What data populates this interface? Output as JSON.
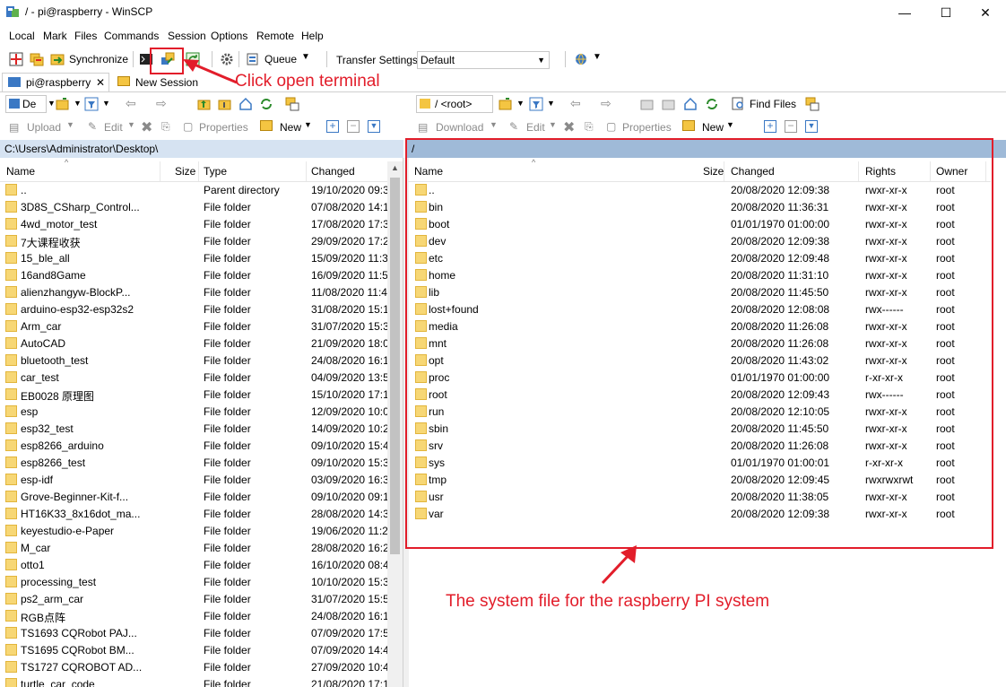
{
  "window": {
    "title": "/ - pi@raspberry - WinSCP",
    "minimize": "—",
    "maximize": "☐",
    "close": "✕"
  },
  "menu": [
    "Local",
    "Mark",
    "Files",
    "Commands",
    "Session",
    "Options",
    "Remote",
    "Help"
  ],
  "toolbar": {
    "synchronize": "Synchronize",
    "queue": "Queue",
    "transfer_settings_label": "Transfer Settings",
    "transfer_settings_value": "Default"
  },
  "tabs": {
    "session": "pi@raspberry",
    "new_session": "New Session"
  },
  "annotations": {
    "terminal": "Click open terminal",
    "system": "The system file for the raspberry PI system"
  },
  "local": {
    "drive_label": "De",
    "actions": {
      "upload": "Upload",
      "edit": "Edit",
      "properties": "Properties",
      "new": "New"
    },
    "path": "C:\\Users\\Administrator\\Desktop\\",
    "columns": {
      "name": "Name",
      "size": "Size",
      "type": "Type",
      "changed": "Changed"
    },
    "rows": [
      {
        "name": "..",
        "type": "Parent directory",
        "changed": "19/10/2020 09:3"
      },
      {
        "name": "3D8S_CSharp_Control...",
        "type": "File folder",
        "changed": "07/08/2020 14:1"
      },
      {
        "name": "4wd_motor_test",
        "type": "File folder",
        "changed": "17/08/2020 17:3"
      },
      {
        "name": "7大课程收获",
        "type": "File folder",
        "changed": "29/09/2020 17:2"
      },
      {
        "name": "15_ble_all",
        "type": "File folder",
        "changed": "15/09/2020 11:3"
      },
      {
        "name": "16and8Game",
        "type": "File folder",
        "changed": "16/09/2020 11:5"
      },
      {
        "name": "alienzhangyw-BlockP...",
        "type": "File folder",
        "changed": "11/08/2020 11:4"
      },
      {
        "name": "arduino-esp32-esp32s2",
        "type": "File folder",
        "changed": "31/08/2020 15:1"
      },
      {
        "name": "Arm_car",
        "type": "File folder",
        "changed": "31/07/2020 15:3"
      },
      {
        "name": "AutoCAD",
        "type": "File folder",
        "changed": "21/09/2020 18:0"
      },
      {
        "name": "bluetooth_test",
        "type": "File folder",
        "changed": "24/08/2020 16:1"
      },
      {
        "name": "car_test",
        "type": "File folder",
        "changed": "04/09/2020 13:5"
      },
      {
        "name": "EB0028 原理图",
        "type": "File folder",
        "changed": "15/10/2020 17:1"
      },
      {
        "name": "esp",
        "type": "File folder",
        "changed": "12/09/2020 10:0"
      },
      {
        "name": "esp32_test",
        "type": "File folder",
        "changed": "14/09/2020 10:2"
      },
      {
        "name": "esp8266_arduino",
        "type": "File folder",
        "changed": "09/10/2020 15:4"
      },
      {
        "name": "esp8266_test",
        "type": "File folder",
        "changed": "09/10/2020 15:3"
      },
      {
        "name": "esp-idf",
        "type": "File folder",
        "changed": "03/09/2020 16:3"
      },
      {
        "name": "Grove-Beginner-Kit-f...",
        "type": "File folder",
        "changed": "09/10/2020 09:1"
      },
      {
        "name": "HT16K33_8x16dot_ma...",
        "type": "File folder",
        "changed": "28/08/2020 14:3"
      },
      {
        "name": "keyestudio-e-Paper",
        "type": "File folder",
        "changed": "19/06/2020 11:2"
      },
      {
        "name": "M_car",
        "type": "File folder",
        "changed": "28/08/2020 16:2"
      },
      {
        "name": "otto1",
        "type": "File folder",
        "changed": "16/10/2020 08:4"
      },
      {
        "name": "processing_test",
        "type": "File folder",
        "changed": "10/10/2020 15:3"
      },
      {
        "name": "ps2_arm_car",
        "type": "File folder",
        "changed": "31/07/2020 15:5"
      },
      {
        "name": "RGB点阵",
        "type": "File folder",
        "changed": "24/08/2020 16:1"
      },
      {
        "name": "TS1693 CQRobot PAJ...",
        "type": "File folder",
        "changed": "07/09/2020 17:5"
      },
      {
        "name": "TS1695 CQRobot BM...",
        "type": "File folder",
        "changed": "07/09/2020 14:4"
      },
      {
        "name": "TS1727 CQROBOT AD...",
        "type": "File folder",
        "changed": "27/09/2020 10:4"
      },
      {
        "name": "turtle_car_code",
        "type": "File folder",
        "changed": "21/08/2020 17:1"
      }
    ]
  },
  "remote": {
    "path_combo": "/ <root>",
    "find_files": "Find Files",
    "actions": {
      "download": "Download",
      "edit": "Edit",
      "properties": "Properties",
      "new": "New"
    },
    "path": "/",
    "columns": {
      "name": "Name",
      "size": "Size",
      "changed": "Changed",
      "rights": "Rights",
      "owner": "Owner"
    },
    "rows": [
      {
        "name": "..",
        "changed": "20/08/2020 12:09:38",
        "rights": "rwxr-xr-x",
        "owner": "root"
      },
      {
        "name": "bin",
        "changed": "20/08/2020 11:36:31",
        "rights": "rwxr-xr-x",
        "owner": "root"
      },
      {
        "name": "boot",
        "changed": "01/01/1970 01:00:00",
        "rights": "rwxr-xr-x",
        "owner": "root"
      },
      {
        "name": "dev",
        "changed": "20/08/2020 12:09:38",
        "rights": "rwxr-xr-x",
        "owner": "root"
      },
      {
        "name": "etc",
        "changed": "20/08/2020 12:09:48",
        "rights": "rwxr-xr-x",
        "owner": "root"
      },
      {
        "name": "home",
        "changed": "20/08/2020 11:31:10",
        "rights": "rwxr-xr-x",
        "owner": "root"
      },
      {
        "name": "lib",
        "changed": "20/08/2020 11:45:50",
        "rights": "rwxr-xr-x",
        "owner": "root"
      },
      {
        "name": "lost+found",
        "changed": "20/08/2020 12:08:08",
        "rights": "rwx------",
        "owner": "root"
      },
      {
        "name": "media",
        "changed": "20/08/2020 11:26:08",
        "rights": "rwxr-xr-x",
        "owner": "root"
      },
      {
        "name": "mnt",
        "changed": "20/08/2020 11:26:08",
        "rights": "rwxr-xr-x",
        "owner": "root"
      },
      {
        "name": "opt",
        "changed": "20/08/2020 11:43:02",
        "rights": "rwxr-xr-x",
        "owner": "root"
      },
      {
        "name": "proc",
        "changed": "01/01/1970 01:00:00",
        "rights": "r-xr-xr-x",
        "owner": "root"
      },
      {
        "name": "root",
        "changed": "20/08/2020 12:09:43",
        "rights": "rwx------",
        "owner": "root"
      },
      {
        "name": "run",
        "changed": "20/08/2020 12:10:05",
        "rights": "rwxr-xr-x",
        "owner": "root"
      },
      {
        "name": "sbin",
        "changed": "20/08/2020 11:45:50",
        "rights": "rwxr-xr-x",
        "owner": "root"
      },
      {
        "name": "srv",
        "changed": "20/08/2020 11:26:08",
        "rights": "rwxr-xr-x",
        "owner": "root"
      },
      {
        "name": "sys",
        "changed": "01/01/1970 01:00:01",
        "rights": "r-xr-xr-x",
        "owner": "root"
      },
      {
        "name": "tmp",
        "changed": "20/08/2020 12:09:45",
        "rights": "rwxrwxrwt",
        "owner": "root"
      },
      {
        "name": "usr",
        "changed": "20/08/2020 11:38:05",
        "rights": "rwxr-xr-x",
        "owner": "root"
      },
      {
        "name": "var",
        "changed": "20/08/2020 12:09:38",
        "rights": "rwxr-xr-x",
        "owner": "root"
      }
    ]
  }
}
